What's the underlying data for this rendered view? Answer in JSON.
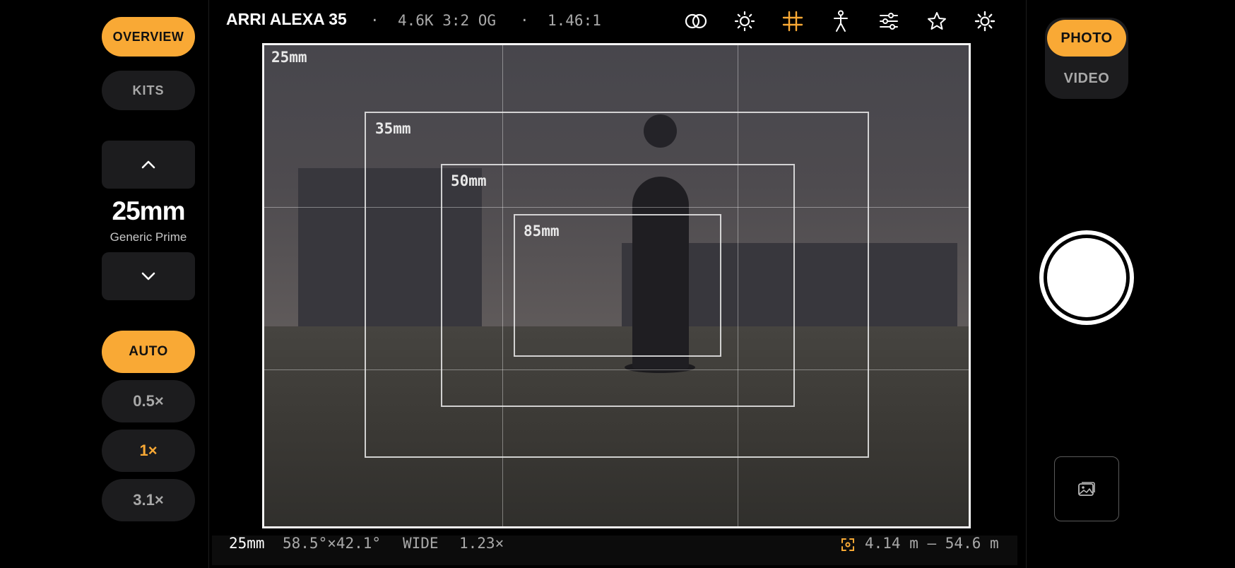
{
  "left_panel": {
    "overview_label": "OVERVIEW",
    "kits_label": "KITS",
    "focal_length": "25mm",
    "lens_name": "Generic Prime",
    "auto_label": "AUTO",
    "zoom_options": [
      "0.5×",
      "1×",
      "3.1×"
    ],
    "selected_zoom": "1×"
  },
  "top_bar": {
    "camera_name": "ARRI ALEXA 35",
    "sep1": "·",
    "format": "4.6K 3:2 OG",
    "sep2": "·",
    "aspect_ratio": "1.46:1",
    "icons": [
      "compare-circles-icon",
      "exposure-sun-icon",
      "grid-icon",
      "person-icon",
      "sliders-icon",
      "star-icon",
      "settings-gear-icon"
    ],
    "active_icon": "grid-icon"
  },
  "viewfinder": {
    "frame_labels": [
      "25mm",
      "35mm",
      "50mm",
      "85mm"
    ]
  },
  "bottom_bar": {
    "focal": "25mm",
    "fov": "58.5°×42.1°",
    "lens_class": "WIDE",
    "magnification": "1.23×",
    "focus_range": "4.14 m — 54.6 m"
  },
  "right_panel": {
    "photo_label": "PHOTO",
    "video_label": "VIDEO",
    "active_mode": "PHOTO"
  },
  "colors": {
    "accent": "#f9a935",
    "panel_bg": "#1c1c1e",
    "background": "#000000"
  }
}
